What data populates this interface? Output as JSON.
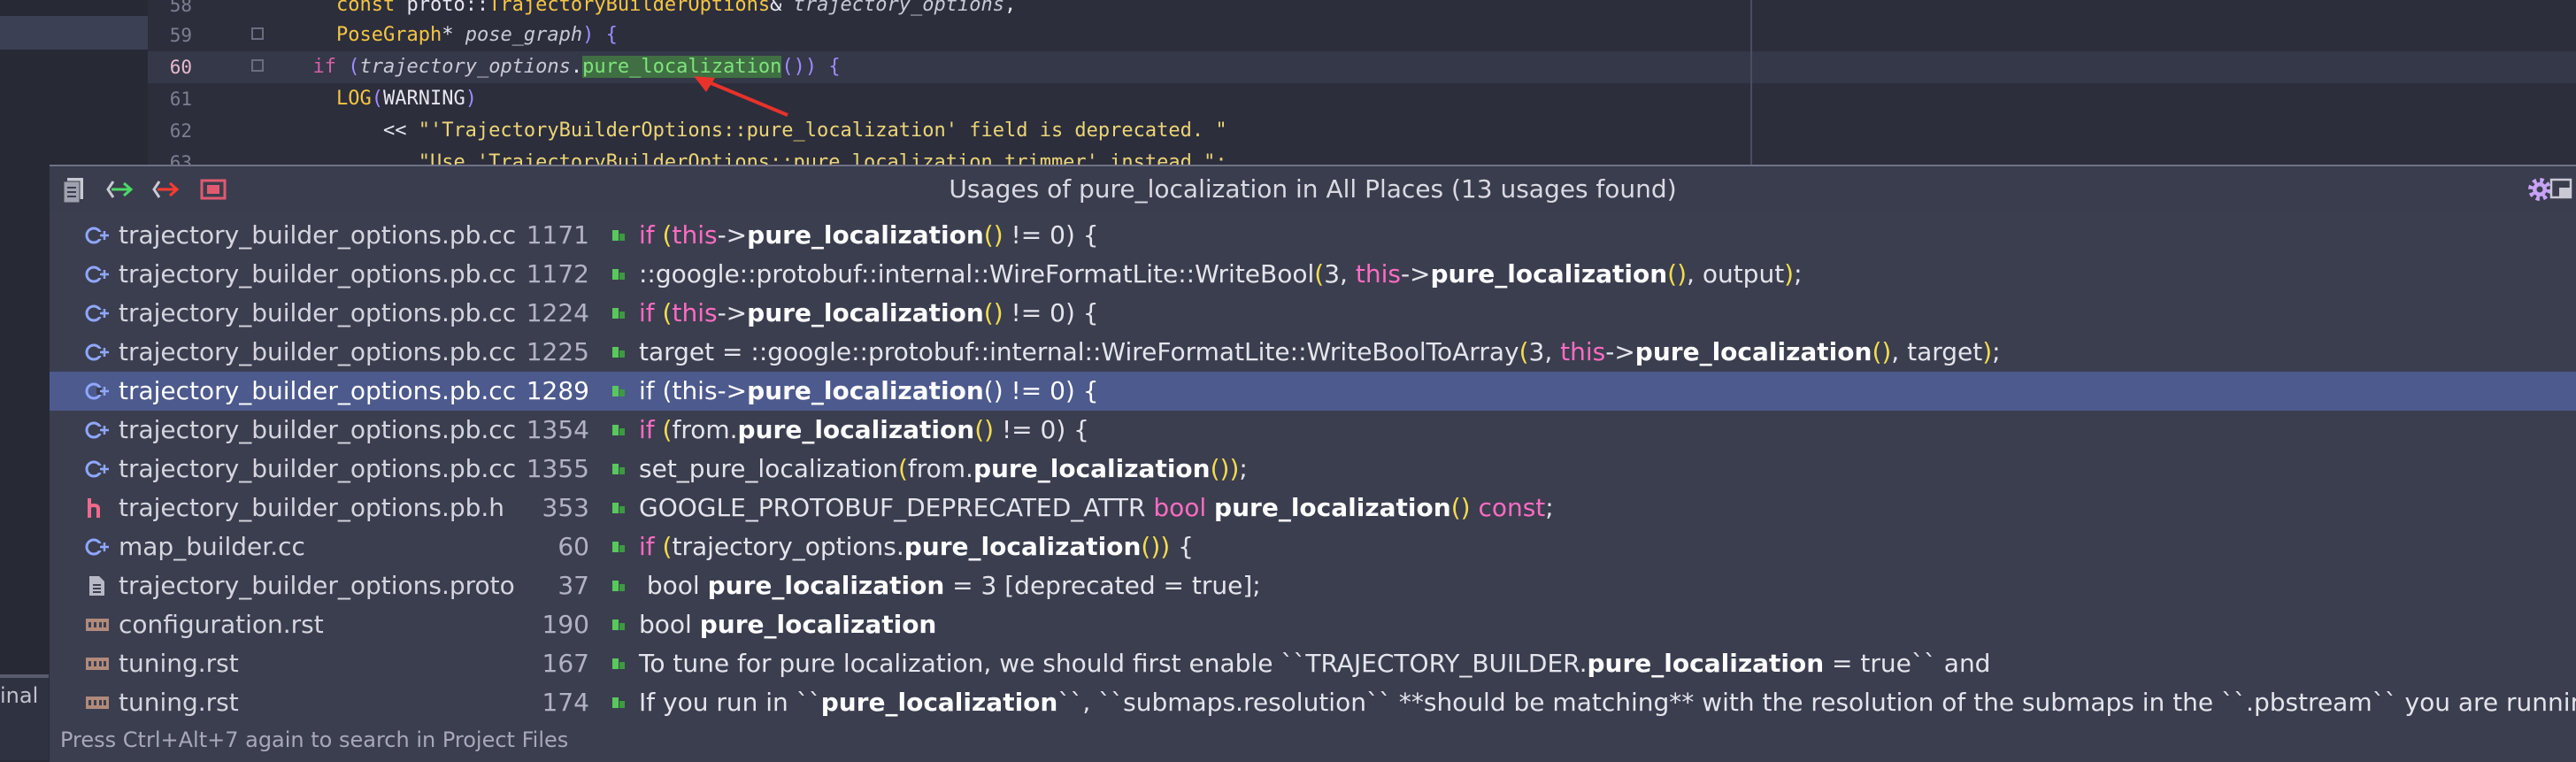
{
  "sidebar": {
    "label": "inal"
  },
  "editor": {
    "lines": [
      {
        "num": "58",
        "segments": [
          {
            "t": "    ",
            "c": ""
          },
          {
            "t": "const",
            "c": "kw"
          },
          {
            "t": " proto::",
            "c": ""
          },
          {
            "t": "TrajectoryBuilderOptions",
            "c": "kw"
          },
          {
            "t": "& ",
            "c": ""
          },
          {
            "t": "trajectory_options",
            "c": "it"
          },
          {
            "t": ",",
            "c": ""
          }
        ]
      },
      {
        "num": "59",
        "segments": [
          {
            "t": "    ",
            "c": ""
          },
          {
            "t": "PoseGraph",
            "c": "kw"
          },
          {
            "t": "* ",
            "c": ""
          },
          {
            "t": "pose_graph",
            "c": "it"
          },
          {
            "t": ") {",
            "c": "br"
          }
        ]
      },
      {
        "num": "60",
        "segments": [
          {
            "t": "  ",
            "c": ""
          },
          {
            "t": "if",
            "c": "fn"
          },
          {
            "t": " (",
            "c": "br"
          },
          {
            "t": "trajectory_options",
            "c": "it"
          },
          {
            "t": ".",
            "c": ""
          },
          {
            "t": "pure_localization",
            "c": "hl"
          },
          {
            "t": "()",
            "c": "br"
          },
          {
            "t": ") {",
            "c": "br"
          }
        ]
      },
      {
        "num": "61",
        "segments": [
          {
            "t": "    ",
            "c": ""
          },
          {
            "t": "LOG",
            "c": "kw"
          },
          {
            "t": "(",
            "c": "br"
          },
          {
            "t": "WARNING",
            "c": ""
          },
          {
            "t": ")",
            "c": "br"
          }
        ]
      },
      {
        "num": "62",
        "segments": [
          {
            "t": "        << ",
            "c": ""
          },
          {
            "t": "\"'TrajectoryBuilderOptions::pure_localization' field is deprecated. \"",
            "c": "st"
          }
        ]
      },
      {
        "num": "63",
        "segments": [
          {
            "t": "           ",
            "c": ""
          },
          {
            "t": "\"Use 'TrajectoryBuilderOptions::pure_localization_trimmer' instead.\";",
            "c": "st"
          }
        ]
      }
    ]
  },
  "popup": {
    "title": "Usages of pure_localization in All Places (13 usages found)",
    "footer": "Press Ctrl+Alt+7 again to search in Project Files",
    "toolbar": [
      "file-icon",
      "previous-occurrence-icon",
      "next-occurrence-icon",
      "merge-icon"
    ],
    "rows": [
      {
        "icon": "cpp-file-icon",
        "file": "trajectory_builder_options.pb.cc",
        "line": "1171",
        "snippet": [
          {
            "t": "if ",
            "c": "k"
          },
          {
            "t": "(",
            "c": "p"
          },
          {
            "t": "this",
            "c": "k"
          },
          {
            "t": "->",
            "c": ""
          },
          {
            "t": "pure_localization",
            "c": "b"
          },
          {
            "t": "()",
            "c": "p"
          },
          {
            "t": " != 0) {",
            "c": ""
          }
        ]
      },
      {
        "icon": "cpp-file-icon",
        "file": "trajectory_builder_options.pb.cc",
        "line": "1172",
        "snippet": [
          {
            "t": "::google::protobuf::internal::WireFormatLite::WriteBool",
            "c": ""
          },
          {
            "t": "(",
            "c": "p"
          },
          {
            "t": "3, ",
            "c": ""
          },
          {
            "t": "this",
            "c": "k"
          },
          {
            "t": "->",
            "c": ""
          },
          {
            "t": "pure_localization",
            "c": "b"
          },
          {
            "t": "()",
            "c": "p"
          },
          {
            "t": ", output",
            "c": ""
          },
          {
            "t": ")",
            "c": "p"
          },
          {
            "t": ";",
            "c": ""
          }
        ]
      },
      {
        "icon": "cpp-file-icon",
        "file": "trajectory_builder_options.pb.cc",
        "line": "1224",
        "snippet": [
          {
            "t": "if ",
            "c": "k"
          },
          {
            "t": "(",
            "c": "p"
          },
          {
            "t": "this",
            "c": "k"
          },
          {
            "t": "->",
            "c": ""
          },
          {
            "t": "pure_localization",
            "c": "b"
          },
          {
            "t": "()",
            "c": "p"
          },
          {
            "t": " != 0) {",
            "c": ""
          }
        ]
      },
      {
        "icon": "cpp-file-icon",
        "file": "trajectory_builder_options.pb.cc",
        "line": "1225",
        "snippet": [
          {
            "t": "target = ::google::protobuf::internal::WireFormatLite::WriteBoolToArray",
            "c": ""
          },
          {
            "t": "(",
            "c": "p"
          },
          {
            "t": "3, ",
            "c": ""
          },
          {
            "t": "this",
            "c": "k"
          },
          {
            "t": "->",
            "c": ""
          },
          {
            "t": "pure_localization",
            "c": "b"
          },
          {
            "t": "()",
            "c": "p"
          },
          {
            "t": ", target",
            "c": ""
          },
          {
            "t": ")",
            "c": "p"
          },
          {
            "t": ";",
            "c": ""
          }
        ]
      },
      {
        "icon": "cpp-file-icon",
        "file": "trajectory_builder_options.pb.cc",
        "line": "1289",
        "selected": true,
        "snippet": [
          {
            "t": "if (this->",
            "c": ""
          },
          {
            "t": "pure_localization",
            "c": "b"
          },
          {
            "t": "() != 0) {",
            "c": ""
          }
        ]
      },
      {
        "icon": "cpp-file-icon",
        "file": "trajectory_builder_options.pb.cc",
        "line": "1354",
        "snippet": [
          {
            "t": "if ",
            "c": "k"
          },
          {
            "t": "(",
            "c": "p"
          },
          {
            "t": "from.",
            "c": ""
          },
          {
            "t": "pure_localization",
            "c": "b"
          },
          {
            "t": "()",
            "c": "p"
          },
          {
            "t": " != 0) {",
            "c": ""
          }
        ]
      },
      {
        "icon": "cpp-file-icon",
        "file": "trajectory_builder_options.pb.cc",
        "line": "1355",
        "snippet": [
          {
            "t": "set_pure_localization",
            "c": ""
          },
          {
            "t": "(",
            "c": "p"
          },
          {
            "t": "from.",
            "c": ""
          },
          {
            "t": "pure_localization",
            "c": "b"
          },
          {
            "t": "())",
            "c": "p"
          },
          {
            "t": ";",
            "c": ""
          }
        ]
      },
      {
        "icon": "header-file-icon",
        "file": "trajectory_builder_options.pb.h",
        "line": "353",
        "snippet": [
          {
            "t": "GOOGLE_PROTOBUF_DEPRECATED_ATTR ",
            "c": ""
          },
          {
            "t": "bool ",
            "c": "k"
          },
          {
            "t": "pure_localization",
            "c": "b"
          },
          {
            "t": "() ",
            "c": "p"
          },
          {
            "t": "const",
            "c": "k"
          },
          {
            "t": ";",
            "c": ""
          }
        ]
      },
      {
        "icon": "cpp-file-icon",
        "file": "map_builder.cc",
        "line": "60",
        "snippet": [
          {
            "t": "if ",
            "c": "k"
          },
          {
            "t": "(",
            "c": "p"
          },
          {
            "t": "trajectory_options.",
            "c": ""
          },
          {
            "t": "pure_localization",
            "c": "b"
          },
          {
            "t": "())",
            "c": "p"
          },
          {
            "t": " {",
            "c": ""
          }
        ]
      },
      {
        "icon": "proto-file-icon",
        "file": "trajectory_builder_options.proto",
        "line": "37",
        "snippet": [
          {
            "t": " bool ",
            "c": ""
          },
          {
            "t": "pure_localization",
            "c": "b"
          },
          {
            "t": " = 3 [deprecated = true];",
            "c": ""
          }
        ]
      },
      {
        "icon": "rst-file-icon",
        "file": "configuration.rst",
        "line": "190",
        "snippet": [
          {
            "t": "bool ",
            "c": ""
          },
          {
            "t": "pure_localization",
            "c": "b"
          }
        ]
      },
      {
        "icon": "rst-file-icon",
        "file": "tuning.rst",
        "line": "167",
        "snippet": [
          {
            "t": "To tune for pure localization, we should first enable ``TRAJECTORY_BUILDER.",
            "c": ""
          },
          {
            "t": "pure_localization",
            "c": "b"
          },
          {
            "t": " = true`` and",
            "c": ""
          }
        ]
      },
      {
        "icon": "rst-file-icon",
        "file": "tuning.rst",
        "line": "174",
        "snippet": [
          {
            "t": "If you run in ``",
            "c": ""
          },
          {
            "t": "pure_localization",
            "c": "b"
          },
          {
            "t": "``, ``submaps.resolution`` **should be matching** with the resolution of the submaps in the ``.pbstream`` you are running on.",
            "c": ""
          }
        ]
      }
    ]
  }
}
